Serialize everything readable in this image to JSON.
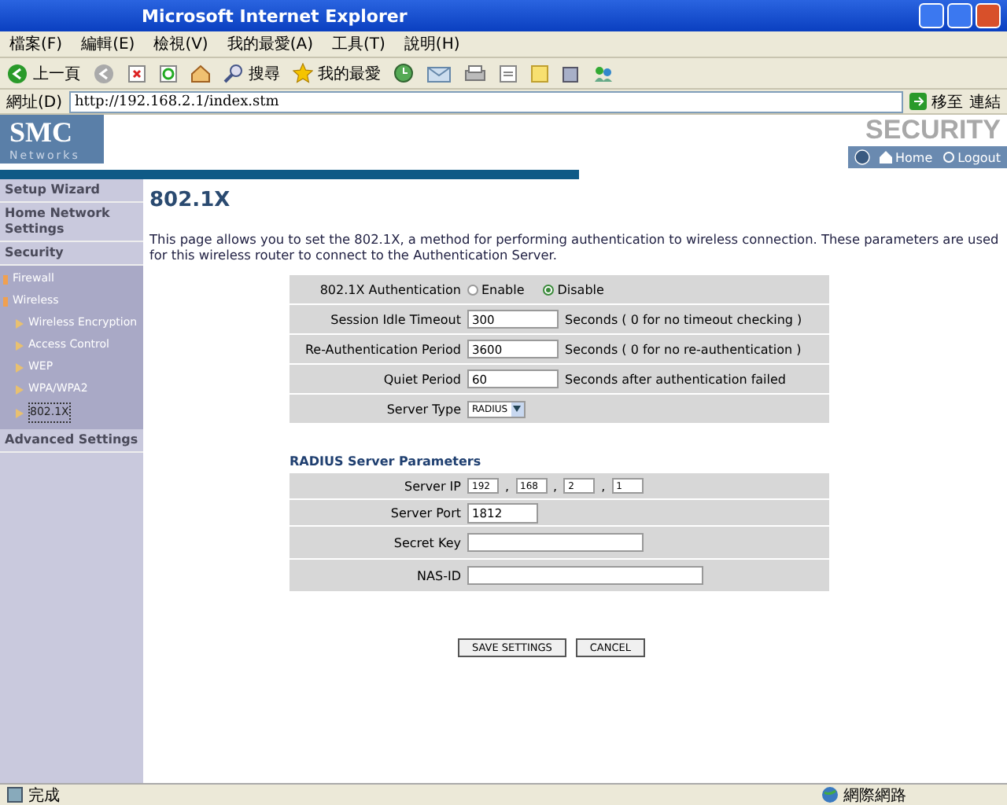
{
  "window": {
    "title": "Microsoft Internet Explorer"
  },
  "menu": [
    "檔案(F)",
    "編輯(E)",
    "檢視(V)",
    "我的最愛(A)",
    "工具(T)",
    "說明(H)"
  ],
  "toolbar": {
    "back": "上一頁",
    "search": "搜尋",
    "favorites": "我的最愛"
  },
  "address": {
    "label": "網址(D)",
    "value": "http://192.168.2.1/index.stm",
    "go": "移至",
    "links": "連結"
  },
  "header": {
    "logo": "SMC",
    "logo_sub": "Networks",
    "banner": "SECURITY",
    "home": "Home",
    "logout": "Logout"
  },
  "sidebar": [
    {
      "label": "Setup Wizard"
    },
    {
      "label": "Home Network Settings"
    },
    {
      "label": "Security",
      "children": [
        {
          "label": "Firewall",
          "selected": false
        },
        {
          "label": "Wireless",
          "selected": false,
          "children": [
            {
              "label": "Wireless Encryption",
              "selected": false
            },
            {
              "label": "Access Control",
              "selected": false
            },
            {
              "label": "WEP",
              "selected": false
            },
            {
              "label": "WPA/WPA2",
              "selected": false
            },
            {
              "label": "802.1X",
              "selected": true
            }
          ]
        }
      ]
    },
    {
      "label": "Advanced Settings"
    }
  ],
  "page": {
    "title": "802.1X",
    "intro": "This page allows you to set the 802.1X, a method for performing authentication to wireless connection.  These parameters are used for this wireless router to connect to the Authentication Server."
  },
  "settings": [
    {
      "kind": "radio",
      "label": "802.1X Authentication",
      "options": [
        {
          "label": "Enable",
          "selected": false
        },
        {
          "label": "Disable",
          "selected": true
        }
      ]
    },
    {
      "kind": "text",
      "label": "Session Idle Timeout",
      "value": "300",
      "note": "Seconds ( 0 for no timeout checking )"
    },
    {
      "kind": "text",
      "label": "Re-Authentication Period",
      "value": "3600",
      "note": "Seconds ( 0 for no re-authentication )"
    },
    {
      "kind": "text",
      "label": "Quiet Period",
      "value": "60",
      "note": "Seconds after authentication failed"
    },
    {
      "kind": "select",
      "label": "Server Type",
      "value": "RADIUS"
    }
  ],
  "radius": {
    "title": "RADIUS Server Parameters",
    "rows": [
      {
        "kind": "ip",
        "label": "Server IP",
        "parts": [
          "192",
          "168",
          "2",
          "1"
        ],
        "separator": ","
      },
      {
        "kind": "short",
        "label": "Server Port",
        "value": "1812"
      },
      {
        "kind": "medium",
        "label": "Secret Key",
        "value": ""
      },
      {
        "kind": "long",
        "label": "NAS-ID",
        "value": ""
      }
    ]
  },
  "buttons": [
    "SAVE SETTINGS",
    "CANCEL"
  ],
  "status_bar": {
    "text": "完成",
    "zone": "網際網路"
  }
}
